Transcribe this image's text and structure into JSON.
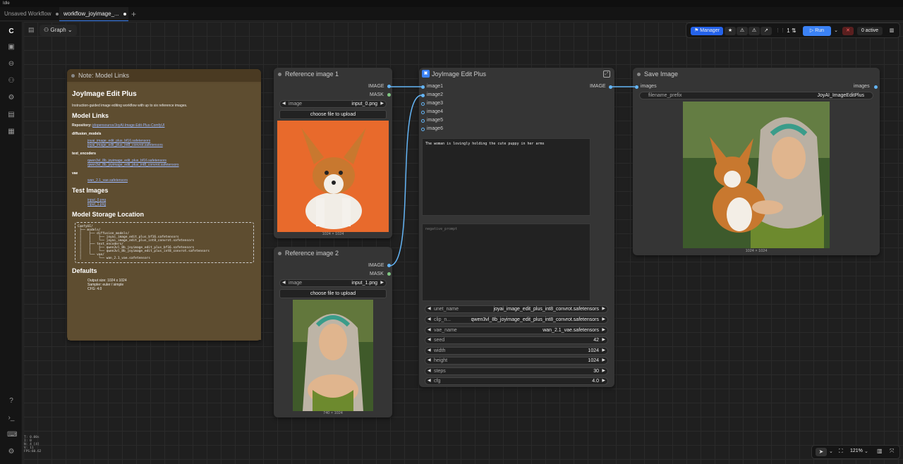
{
  "window": {
    "title": "Idle"
  },
  "tabs": [
    {
      "label": "Unsaved Workflow"
    },
    {
      "label": "workflow_joyimage_..."
    }
  ],
  "toolbar": {
    "graph_label": "Graph",
    "manager_label": "Manager",
    "queue_count": "1",
    "run_label": "Run",
    "active_label": "0 active"
  },
  "note": {
    "header": "Note: Model Links",
    "title": "JoyImage Edit Plus",
    "desc": "Instruction-guided image editing workflow with up to six reference images.",
    "model_links": "Model Links",
    "repo_label": "Repository:",
    "repo_link": "jdopensource/JoyAI-Image-Edit-Plus-ComfyUI",
    "diffusion": "diffusion_models",
    "diffusion_items": [
      "joyai_image_edit_plus_bf16.safetensors",
      "joyai_image_edit_plus_int8_convrot.safetensors"
    ],
    "text_enc": "text_encoders",
    "text_items": [
      "qwen3vl_8b_joyimage_edit_plus_bf16.safetensors",
      "qwen3vl_8b_joyimage_edit_plus_int8_convrot.safetensors"
    ],
    "vae": "vae",
    "vae_items": [
      "wan_2.1_vae.safetensors"
    ],
    "test_images": "Test Images",
    "test_items": [
      "input_0.png",
      "input_1.png"
    ],
    "storage": "Model Storage Location",
    "tree": "ComfyUI/\n ├── models/\n │    ├── diffusion_models/\n │    │    ├── joyai_image_edit_plus_bf16.safetensors\n │    │    └── joyai_image_edit_plus_int8_convrot.safetensors\n │    ├── text_encoders/\n │    │    ├── qwen3vl_8b_joyimage_edit_plus_bf16.safetensors\n │    │    └── qwen3vl_8b_joyimage_edit_plus_int8_convrot.safetensors\n │    └── vae/\n │         └── wan_2.1_vae.safetensors",
    "defaults": "Defaults",
    "default_items": [
      "Output size: 1024 x 1024",
      "Sampler: euler / simple",
      "CFG: 4.0"
    ]
  },
  "ref1": {
    "header": "Reference image 1",
    "out_image": "IMAGE",
    "out_mask": "MASK",
    "widget_label": "image",
    "widget_value": "input_0.png",
    "upload": "choose file to upload",
    "caption": "1024 × 1024"
  },
  "ref2": {
    "header": "Reference image 2",
    "out_image": "IMAGE",
    "out_mask": "MASK",
    "widget_label": "image",
    "widget_value": "input_1.png",
    "upload": "choose file to upload",
    "caption": "740 × 1024"
  },
  "joy": {
    "header": "JoyImage Edit Plus",
    "inputs": [
      "image1",
      "image2",
      "image3",
      "image4",
      "image5",
      "image6"
    ],
    "output": "IMAGE",
    "prompt": "The woman is lovingly holding the cute puppy in her arms",
    "neg_placeholder": "negative_prompt",
    "widgets": [
      {
        "label": "unet_name",
        "value": "joyai_image_edit_plus_int8_convrot.safetensors"
      },
      {
        "label": "clip_n...",
        "value": "qwen3vl_8b_joyimage_edit_plus_int8_convrot.safetensors"
      },
      {
        "label": "vae_name",
        "value": "wan_2.1_vae.safetensors"
      },
      {
        "label": "seed",
        "value": "42"
      },
      {
        "label": "width",
        "value": "1024"
      },
      {
        "label": "height",
        "value": "1024"
      },
      {
        "label": "steps",
        "value": "30"
      },
      {
        "label": "cfg",
        "value": "4.0"
      }
    ]
  },
  "save": {
    "header": "Save Image",
    "in_label": "images",
    "out_label": "images",
    "prefix_label": "filename_prefix",
    "prefix_value": "JoyAI_ImageEditPlus",
    "caption": "1024 × 1024"
  },
  "bottom": {
    "zoom": "121%"
  },
  "stats": [
    "T: 0.00s",
    "I: 0",
    "N: 4 [4]",
    "V: 11",
    "FPS:60.62"
  ]
}
